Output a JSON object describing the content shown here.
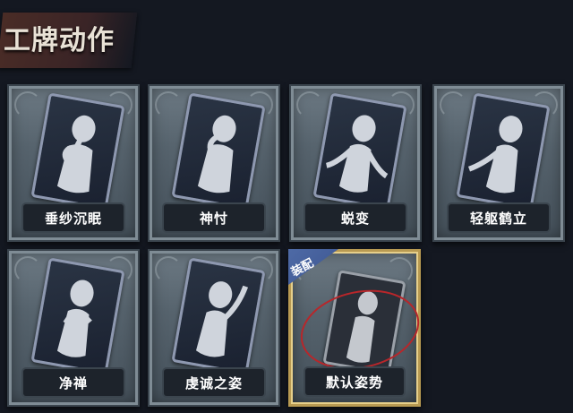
{
  "page": {
    "title": "工牌动作"
  },
  "cards": [
    {
      "name": "垂纱沉眠",
      "equipped": false,
      "pose": "hand-chin"
    },
    {
      "name": "神忖",
      "equipped": false,
      "pose": "hand-face"
    },
    {
      "name": "蜕变",
      "equipped": false,
      "pose": "arms-open"
    },
    {
      "name": "轻躯鹤立",
      "equipped": false,
      "pose": "arm-raise-side"
    },
    {
      "name": "净禅",
      "equipped": false,
      "pose": "hands-crossed"
    },
    {
      "name": "虔诚之姿",
      "equipped": false,
      "pose": "arm-up"
    },
    {
      "name": "默认姿势",
      "equipped": true,
      "badge": "装配",
      "pose": "standing"
    }
  ],
  "colors": {
    "equipped_border": "#b89a52",
    "badge": "#4e6aa6",
    "highlight_ring": "#b8262a"
  }
}
